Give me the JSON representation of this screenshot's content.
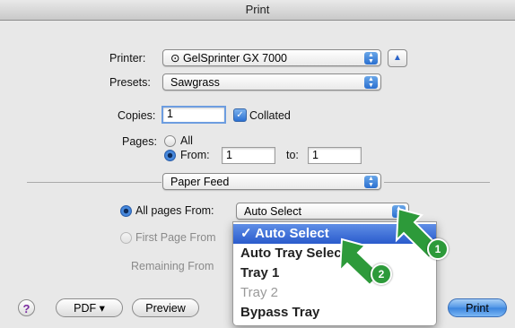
{
  "window": {
    "title": "Print"
  },
  "printer": {
    "label": "Printer:",
    "value": "GelSprinter GX 7000"
  },
  "presets": {
    "label": "Presets:",
    "value": "Sawgrass"
  },
  "copies": {
    "label": "Copies:",
    "value": "1",
    "collated_label": "Collated"
  },
  "pages": {
    "label": "Pages:",
    "all_label": "All",
    "from_label": "From:",
    "from_value": "1",
    "to_label": "to:",
    "to_value": "1"
  },
  "panel": {
    "value": "Paper Feed"
  },
  "paper_feed": {
    "all_pages_from_label": "All pages From:",
    "all_pages_from_value": "Auto Select",
    "first_page_from_label": "First Page From",
    "remaining_from_label": "Remaining From"
  },
  "menu": {
    "items": [
      {
        "label": "✓ Auto Select"
      },
      {
        "label": "Auto Tray Select"
      },
      {
        "label": "Tray 1"
      },
      {
        "label": "Tray 2"
      },
      {
        "label": "Bypass Tray"
      }
    ]
  },
  "footer": {
    "help": "?",
    "pdf_label": "PDF ▾",
    "preview_label": "Preview",
    "print_label": "Print"
  },
  "callouts": {
    "one": "1",
    "two": "2"
  },
  "colors": {
    "accent": "#2a6fd0",
    "callout": "#2d9a3a"
  }
}
